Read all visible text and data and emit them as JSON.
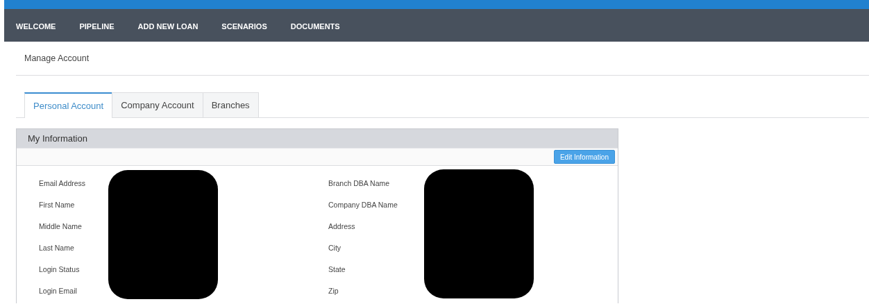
{
  "nav": [
    {
      "label": "WELCOME"
    },
    {
      "label": "PIPELINE"
    },
    {
      "label": "ADD NEW LOAN"
    },
    {
      "label": "SCENARIOS"
    },
    {
      "label": "DOCUMENTS"
    }
  ],
  "page_title": "Manage Account",
  "tabs": [
    {
      "label": "Personal Account",
      "selected": true
    },
    {
      "label": "Company Account",
      "selected": false
    },
    {
      "label": "Branches",
      "selected": false
    }
  ],
  "panel": {
    "title": "My Information",
    "button": "Edit Information",
    "columns": [
      {
        "redacted": true,
        "fields": [
          "Email Address",
          "First Name",
          "Middle Name",
          "Last Name",
          "Login Status",
          "Login Email"
        ]
      },
      {
        "redacted": true,
        "fields": [
          "Branch DBA Name",
          "Company DBA Name",
          "Address",
          "City",
          "State",
          "Zip"
        ]
      }
    ]
  }
}
